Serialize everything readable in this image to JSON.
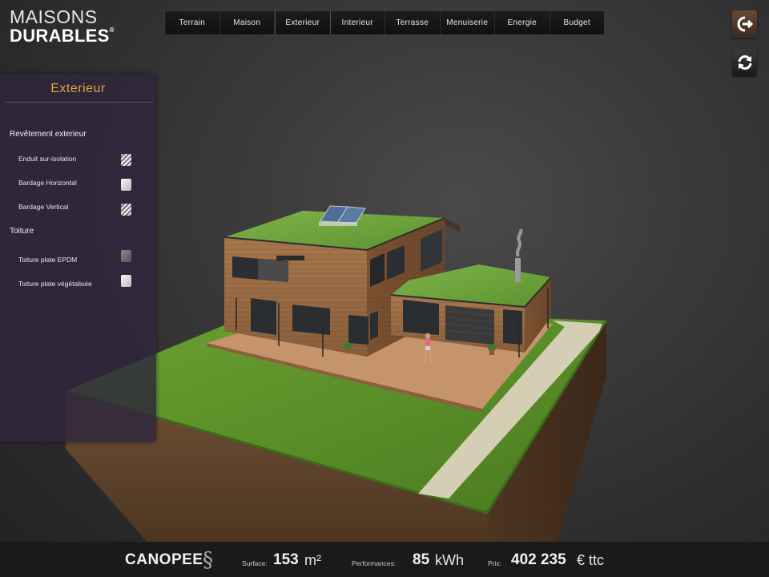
{
  "logo": {
    "line1": "MAISONS",
    "line2": "DURABLES",
    "mark": "®"
  },
  "nav": {
    "tabs": [
      "Terrain",
      "Maison",
      "Exterieur",
      "Interieur",
      "Terrasse",
      "Menuiserie",
      "Energie",
      "Budget"
    ],
    "active": "Exterieur"
  },
  "buttons": {
    "exit_icon": "exit-icon",
    "refresh_icon": "refresh-icon"
  },
  "panel": {
    "title": "Exterieur",
    "sections": [
      {
        "label": "Revêtement exterieur",
        "options": [
          {
            "label": "Enduit sur-isolation",
            "swatch": "striped"
          },
          {
            "label": "Bardage Horizontal",
            "swatch": "plain-light"
          },
          {
            "label": "Bardage Vertical",
            "swatch": "striped"
          }
        ]
      },
      {
        "label": "Toiture",
        "options": [
          {
            "label": "Toiture plate EPDM",
            "swatch": "plain-dark"
          },
          {
            "label": "Toiture plate végétalisée",
            "swatch": "plain-light"
          }
        ]
      }
    ]
  },
  "footer": {
    "model": "CANOPEE",
    "model_icon": "S-logo-icon",
    "surface_label": "Surface:",
    "surface_value": "153",
    "surface_unit": "m²",
    "perf_label": "Performances:",
    "perf_value": "85",
    "perf_unit": "kWh",
    "price_label": "Prix:",
    "price_value": "402 235",
    "price_unit": "€ ttc"
  },
  "colors": {
    "accent_title": "#e0a640",
    "panel_bg": "#2d263c",
    "wood": "#9a6a43",
    "grass": "#5e8f2c",
    "soil": "#6b4a2e"
  }
}
